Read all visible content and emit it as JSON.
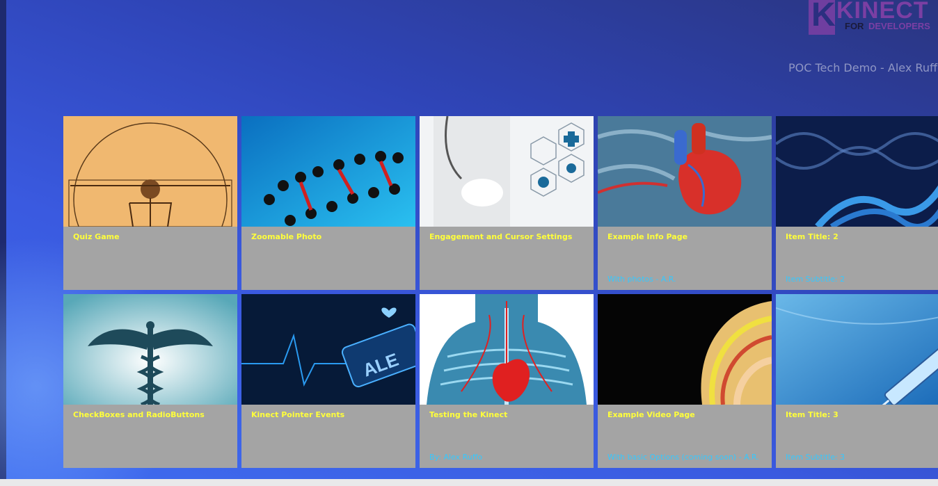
{
  "header": {
    "logo_text": "KINECT",
    "logo_for": "FOR",
    "logo_developers": "DEVELOPERS",
    "subtitle": "POC Tech Demo - Alex Ruffo"
  },
  "tiles": [
    {
      "title": "Quiz Game",
      "subtitle": "",
      "image": "vitruvian-man"
    },
    {
      "title": "Zoomable Photo",
      "subtitle": "",
      "image": "dna-model"
    },
    {
      "title": "Engagement and Cursor Settings",
      "subtitle": "",
      "image": "doctor-icons"
    },
    {
      "title": "Example Info Page",
      "subtitle": "With photos - A.R.",
      "image": "heart-anatomy"
    },
    {
      "title": "Item Title: 2",
      "subtitle": "Item Subtitle: 2",
      "image": "dna-helix"
    },
    {
      "title": "CheckBoxes and RadioButtons",
      "subtitle": "",
      "image": "caduceus"
    },
    {
      "title": "Kinect Pointer Events",
      "subtitle": "",
      "image": "alert-monitor"
    },
    {
      "title": "Testing the Kinect",
      "subtitle": "By: Alex Ruffo",
      "image": "xray-heart"
    },
    {
      "title": "Example Video Page",
      "subtitle": "With basic Options (coming soon) - A.R.",
      "image": "brain-scan"
    },
    {
      "title": "Item Title: 3",
      "subtitle": "Item Subtitle: 3",
      "image": "syringe"
    }
  ],
  "colors": {
    "tile_background": "#a4a4a4",
    "title_color": "#ffff3a",
    "subtitle_color": "#35c8ff",
    "accent_purple": "#7b3fa3"
  }
}
